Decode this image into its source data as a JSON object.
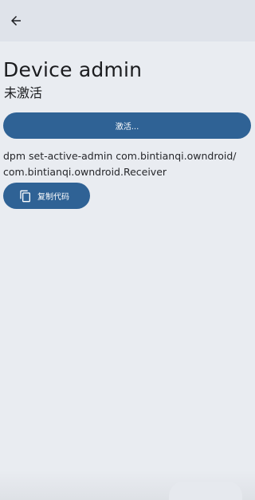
{
  "header": {
    "back_icon": "arrow-left-icon"
  },
  "page": {
    "title": "Device admin",
    "status": "未激活"
  },
  "actions": {
    "activate_label": "激活...",
    "copy_label": "复制代码",
    "copy_icon": "copy-icon"
  },
  "command": {
    "line1": "dpm set-active-admin com.bintianqi.owndroid/",
    "line2": "com.bintianqi.owndroid.Receiver"
  },
  "colors": {
    "button_bg": "#2f6295",
    "background": "#e9ecf1",
    "topbar": "#dfe3ea"
  }
}
